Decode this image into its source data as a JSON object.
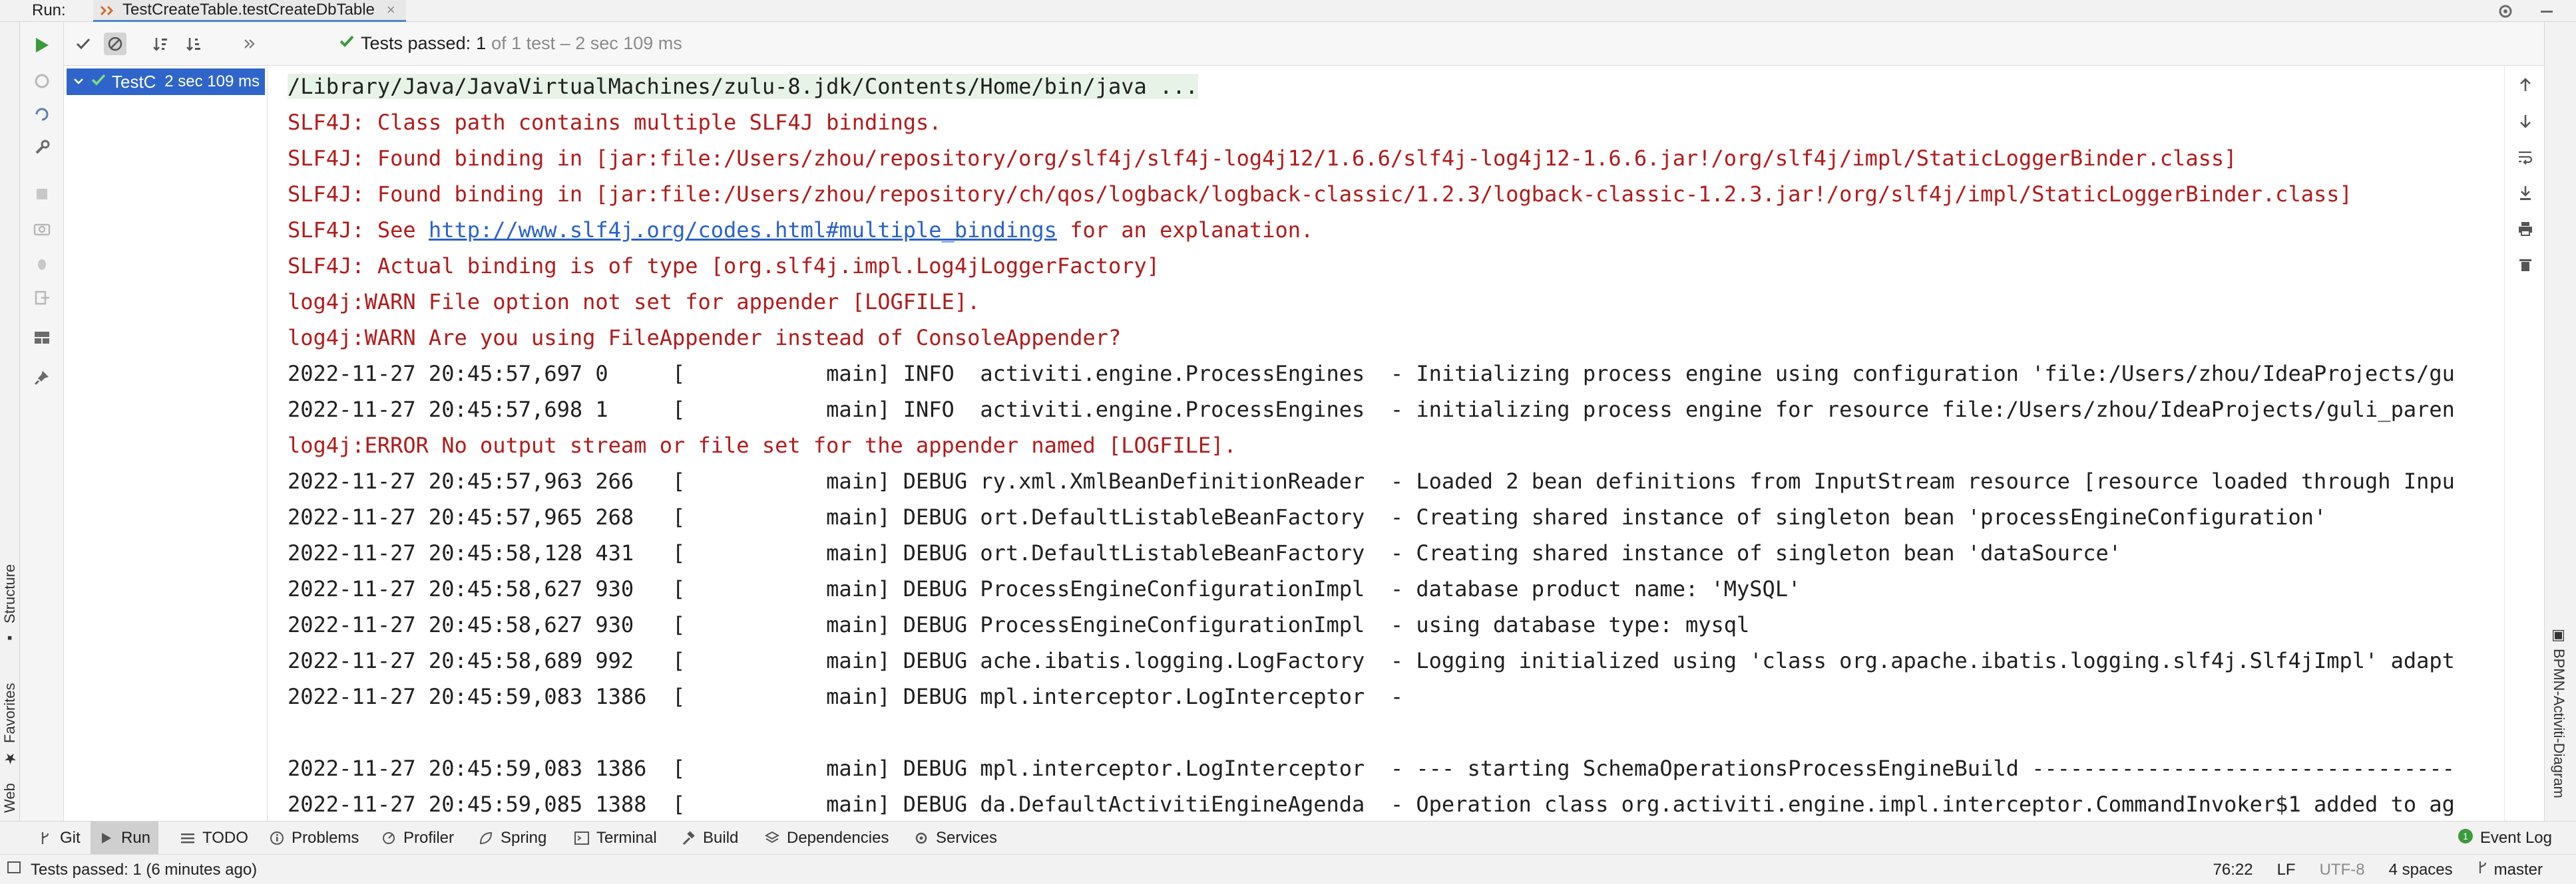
{
  "run_header": {
    "label": "Run:",
    "tab_title": "TestCreateTable.testCreateDbTable",
    "tab_close": "×"
  },
  "test_toolbar": {
    "status_bold": "Tests passed:",
    "status_count": "1",
    "status_rest": "of 1 test – 2 sec 109 ms"
  },
  "tree": {
    "item_label": "TestC",
    "item_time": "2 sec 109 ms"
  },
  "console": {
    "lines": [
      {
        "type": "cmd",
        "text": "/Library/Java/JavaVirtualMachines/zulu-8.jdk/Contents/Home/bin/java ..."
      },
      {
        "type": "err",
        "text": "SLF4J: Class path contains multiple SLF4J bindings."
      },
      {
        "type": "err",
        "text": "SLF4J: Found binding in [jar:file:/Users/zhou/repository/org/slf4j/slf4j-log4j12/1.6.6/slf4j-log4j12-1.6.6.jar!/org/slf4j/impl/StaticLoggerBinder.class]"
      },
      {
        "type": "err",
        "text": "SLF4J: Found binding in [jar:file:/Users/zhou/repository/ch/qos/logback/logback-classic/1.2.3/logback-classic-1.2.3.jar!/org/slf4j/impl/StaticLoggerBinder.class]"
      },
      {
        "type": "err-link",
        "text": "SLF4J: See ",
        "link": "http://www.slf4j.org/codes.html#multiple_bindings",
        "after": " for an explanation."
      },
      {
        "type": "err",
        "text": "SLF4J: Actual binding is of type [org.slf4j.impl.Log4jLoggerFactory]"
      },
      {
        "type": "err",
        "text": "log4j:WARN File option not set for appender [LOGFILE]."
      },
      {
        "type": "err",
        "text": "log4j:WARN Are you using FileAppender instead of ConsoleAppender?"
      },
      {
        "type": "out",
        "text": "2022-11-27 20:45:57,697 0     [           main] INFO  activiti.engine.ProcessEngines  - Initializing process engine using configuration 'file:/Users/zhou/IdeaProjects/gu"
      },
      {
        "type": "out",
        "text": "2022-11-27 20:45:57,698 1     [           main] INFO  activiti.engine.ProcessEngines  - initializing process engine for resource file:/Users/zhou/IdeaProjects/guli_paren"
      },
      {
        "type": "err",
        "text": "log4j:ERROR No output stream or file set for the appender named [LOGFILE]."
      },
      {
        "type": "out",
        "text": "2022-11-27 20:45:57,963 266   [           main] DEBUG ry.xml.XmlBeanDefinitionReader  - Loaded 2 bean definitions from InputStream resource [resource loaded through Inpu"
      },
      {
        "type": "out",
        "text": "2022-11-27 20:45:57,965 268   [           main] DEBUG ort.DefaultListableBeanFactory  - Creating shared instance of singleton bean 'processEngineConfiguration'"
      },
      {
        "type": "out",
        "text": "2022-11-27 20:45:58,128 431   [           main] DEBUG ort.DefaultListableBeanFactory  - Creating shared instance of singleton bean 'dataSource'"
      },
      {
        "type": "out",
        "text": "2022-11-27 20:45:58,627 930   [           main] DEBUG ProcessEngineConfigurationImpl  - database product name: 'MySQL'"
      },
      {
        "type": "out",
        "text": "2022-11-27 20:45:58,627 930   [           main] DEBUG ProcessEngineConfigurationImpl  - using database type: mysql"
      },
      {
        "type": "out",
        "text": "2022-11-27 20:45:58,689 992   [           main] DEBUG ache.ibatis.logging.LogFactory  - Logging initialized using 'class org.apache.ibatis.logging.slf4j.Slf4jImpl' adapt"
      },
      {
        "type": "out",
        "text": "2022-11-27 20:45:59,083 1386  [           main] DEBUG mpl.interceptor.LogInterceptor  - "
      },
      {
        "type": "out",
        "text": ""
      },
      {
        "type": "out",
        "text": "2022-11-27 20:45:59,083 1386  [           main] DEBUG mpl.interceptor.LogInterceptor  - --- starting SchemaOperationsProcessEngineBuild ---------------------------------"
      },
      {
        "type": "out",
        "text": "2022-11-27 20:45:59,085 1388  [           main] DEBUG da.DefaultActivitiEngineAgenda  - Operation class org.activiti.engine.impl.interceptor.CommandInvoker$1 added to ag"
      }
    ]
  },
  "left_strip": {
    "structure": "Structure",
    "favorites": "Favorites",
    "web": "Web"
  },
  "right_strip": {
    "bpmn": "BPMN-Activiti-Diagram"
  },
  "bottom_tabs": {
    "git": "Git",
    "run": "Run",
    "todo": "TODO",
    "problems": "Problems",
    "profiler": "Profiler",
    "spring": "Spring",
    "terminal": "Terminal",
    "build": "Build",
    "dependencies": "Dependencies",
    "services": "Services",
    "event_log": "Event Log",
    "event_count": "1"
  },
  "statusbar": {
    "message": "Tests passed: 1 (6 minutes ago)",
    "position": "76:22",
    "line_sep": "LF",
    "encoding": "UTF-8",
    "indent": "4 spaces",
    "branch": "master"
  },
  "colors": {
    "accent": "#2f65ca",
    "error_text": "#b11b1b",
    "pass_green": "#3b9a3b",
    "link": "#2a62c7"
  }
}
